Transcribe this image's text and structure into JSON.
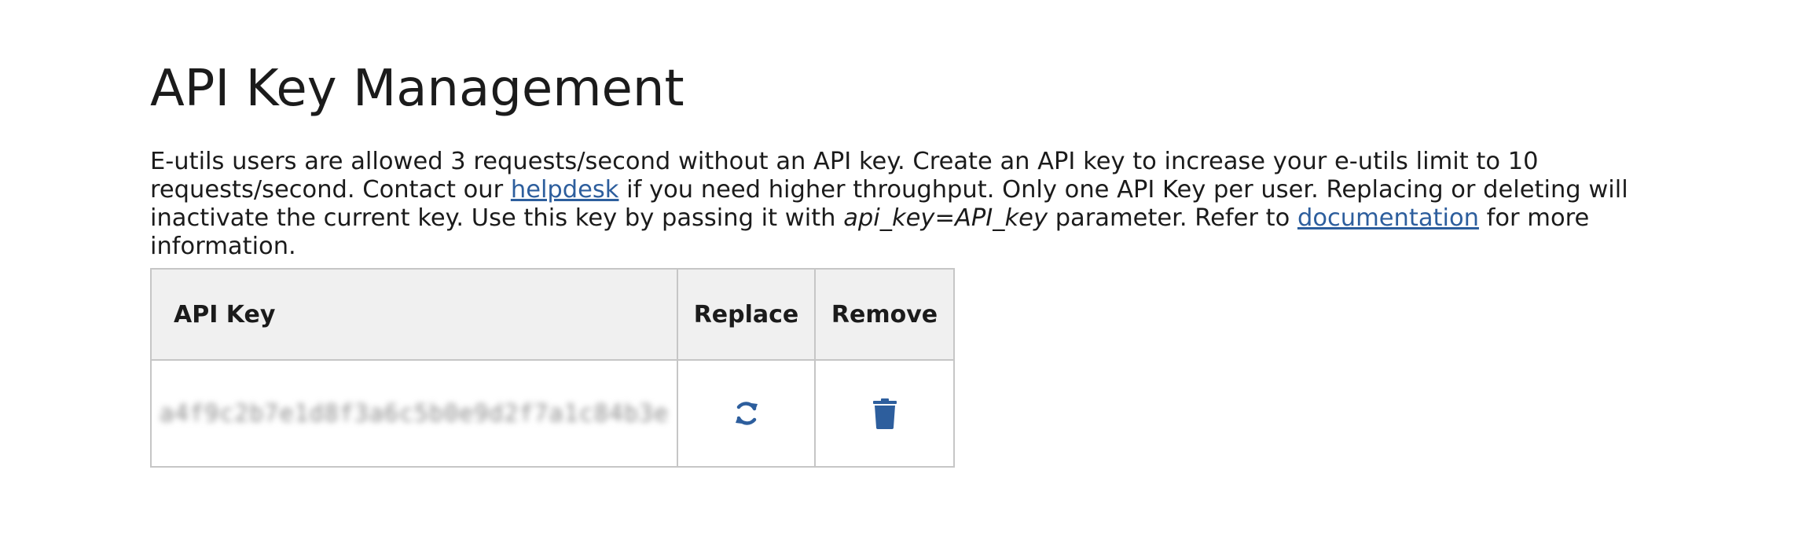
{
  "page": {
    "title": "API Key Management"
  },
  "intro": {
    "part1": "E-utils users are allowed 3 requests/second without an API key. Create an API key to increase your e-utils limit to 10 requests/second. Contact our ",
    "helpdesk_link": "helpdesk",
    "part2": " if you need higher throughput. Only one API Key per user. Replacing or deleting will inactivate the current key. Use this key by passing it with ",
    "param": "api_key=API_key",
    "part3": " parameter. Refer to ",
    "documentation_link": "documentation",
    "part4": " for more information."
  },
  "table": {
    "headers": {
      "api_key": "API Key",
      "replace": "Replace",
      "remove": "Remove"
    },
    "rows": [
      {
        "api_key_value": "a4f9c2b7e1d8f3a6c5b0e9d2f7a1c84b3e",
        "replace_icon": "refresh-icon",
        "remove_icon": "trash-icon"
      }
    ]
  },
  "colors": {
    "link": "#2d5e9d",
    "icon": "#2d5e9d",
    "header_bg": "#f0f0f0",
    "border": "#c6c6c6"
  }
}
